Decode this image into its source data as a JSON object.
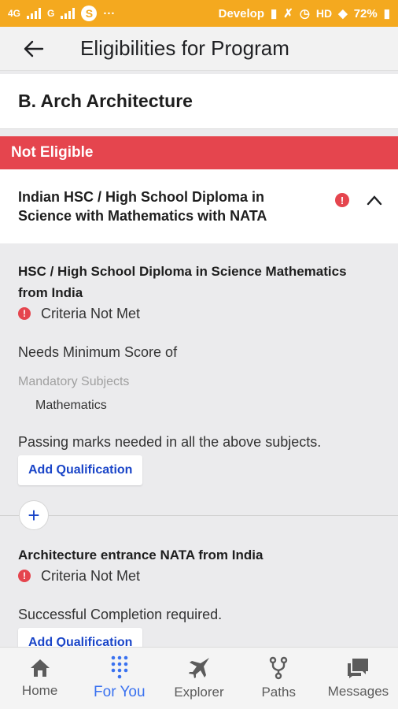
{
  "status_bar": {
    "network1": "4G",
    "network2": "G",
    "skype": "S",
    "dots": "···",
    "carrier": "Develop",
    "hd": "HD",
    "battery": "72%"
  },
  "app_bar": {
    "title": "Eligibilities for Program",
    "back_icon": "arrow-left-icon"
  },
  "program": {
    "name": "B. Arch Architecture"
  },
  "status": {
    "label": "Not Eligible",
    "color": "#e5454e"
  },
  "requirement": {
    "title": "Indian HSC / High School Diploma in Science with Mathematics with NATA",
    "warning_icon": "!",
    "collapse_icon": "chevron-up-icon"
  },
  "qualifications": [
    {
      "title": "HSC / High School Diploma in Science Mathematics from India",
      "criteria": "Criteria Not Met",
      "needs": "Needs Minimum Score of",
      "mandatory_label": "Mandatory Subjects",
      "subject": "Mathematics",
      "note": "Passing marks needed in all the above subjects.",
      "button": "Add Qualification"
    },
    {
      "title": "Architecture entrance NATA from India",
      "criteria": "Criteria Not Met",
      "note": "Successful Completion required.",
      "button": "Add Qualification"
    }
  ],
  "or_button": "+",
  "nav": [
    {
      "label": "Home",
      "icon": "home-icon"
    },
    {
      "label": "For You",
      "icon": "grid-dots-icon",
      "active": true
    },
    {
      "label": "Explorer",
      "icon": "jet-icon"
    },
    {
      "label": "Paths",
      "icon": "fork-icon"
    },
    {
      "label": "Messages",
      "icon": "chat-icon"
    }
  ],
  "colors": {
    "status_bar": "#f4a91f",
    "accent": "#3a72f0",
    "link": "#1a45c8"
  }
}
